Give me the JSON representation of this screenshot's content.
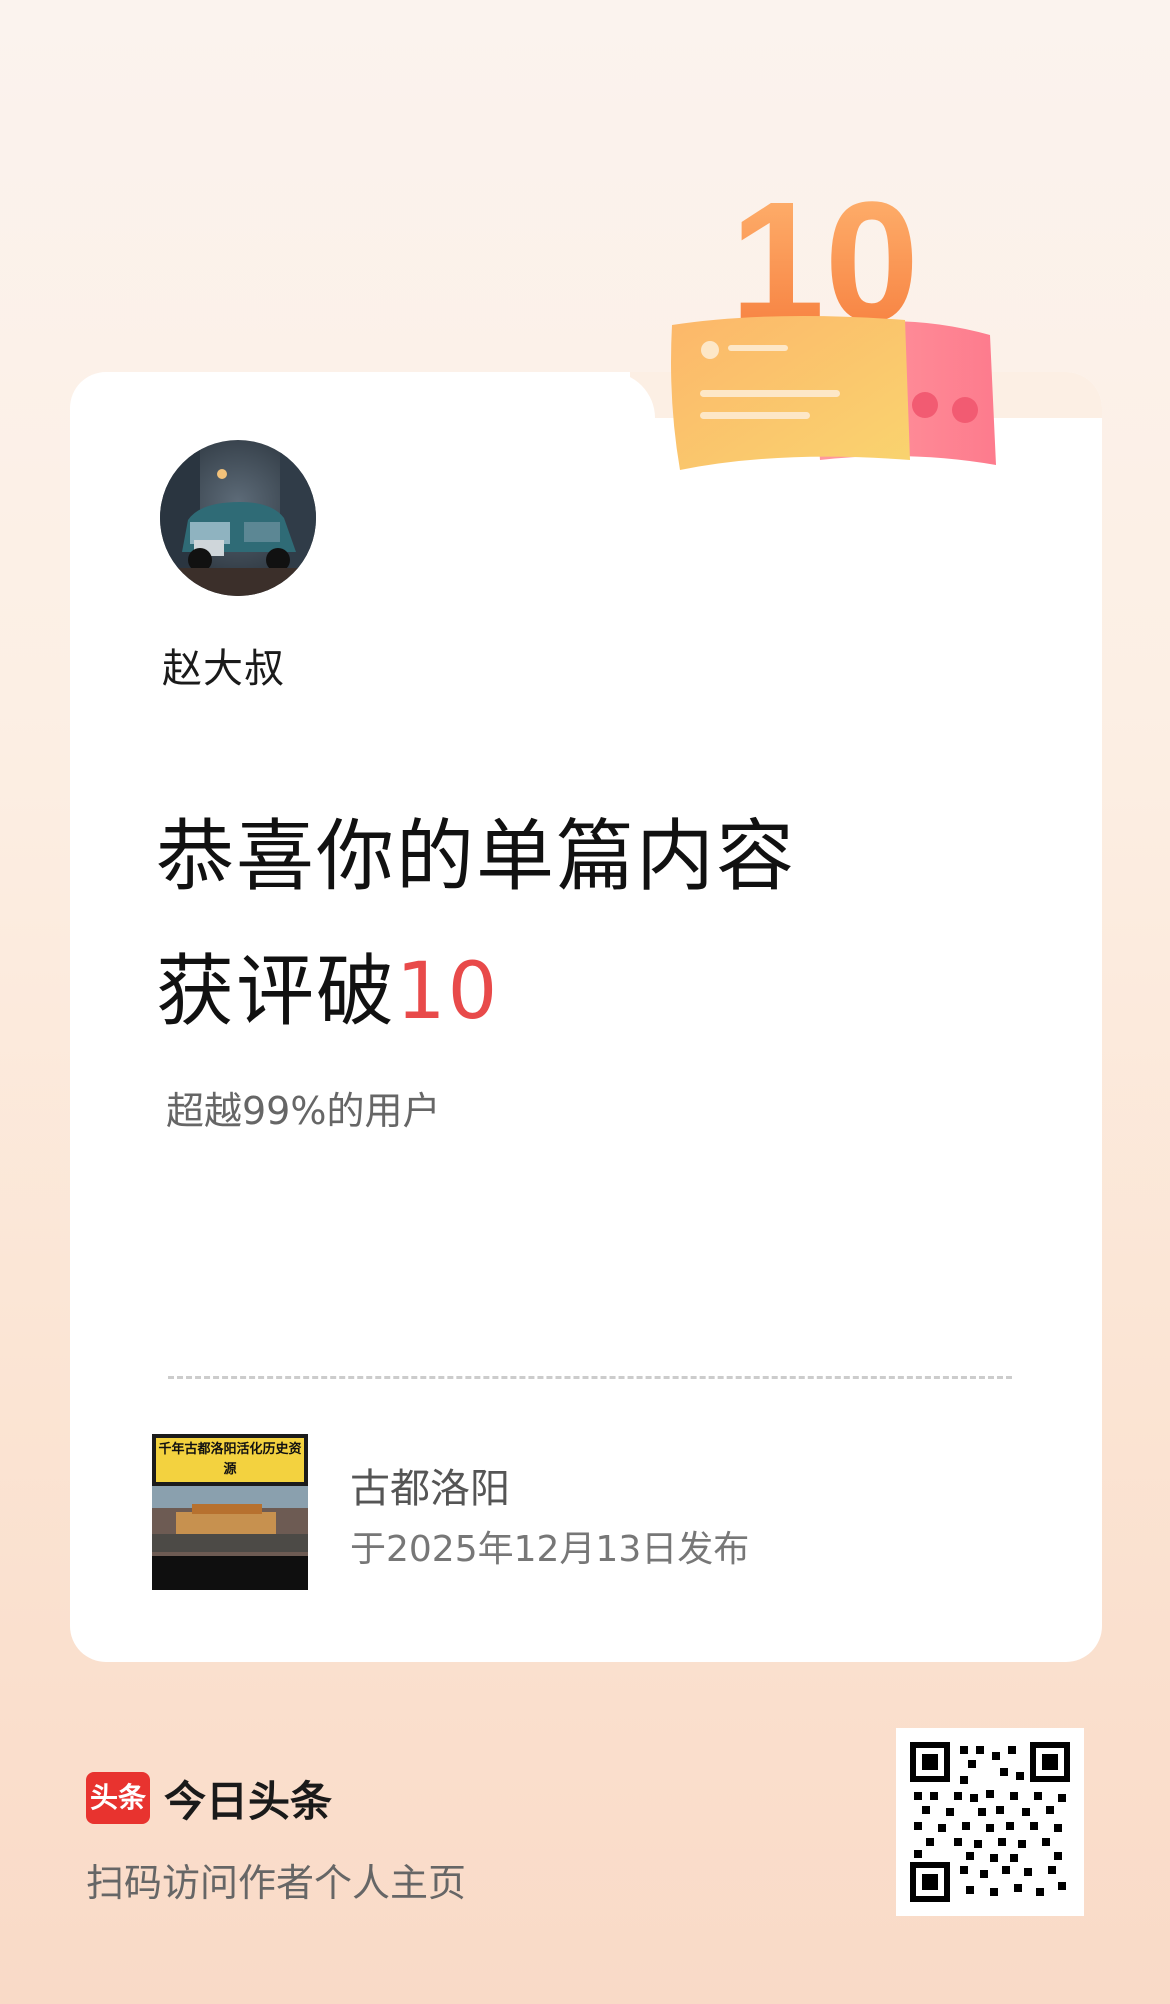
{
  "badge": {
    "number": "10"
  },
  "author": {
    "name": "赵大叔"
  },
  "headline": {
    "line1": "恭喜你的单篇内容",
    "line2_prefix": "获评破",
    "line2_number": "10"
  },
  "subline": "超越99%的用户",
  "article": {
    "thumb_caption": "千年古都洛阳活化历史资源",
    "title": "古都洛阳",
    "date": "于2025年12月13日发布"
  },
  "brand": {
    "logo_text": "头条",
    "name": "今日头条"
  },
  "scan_text": "扫码访问作者个人主页",
  "colors": {
    "accent": "#e84a4a",
    "brand_red": "#e8332f",
    "badge_orange": "#f7994a"
  }
}
